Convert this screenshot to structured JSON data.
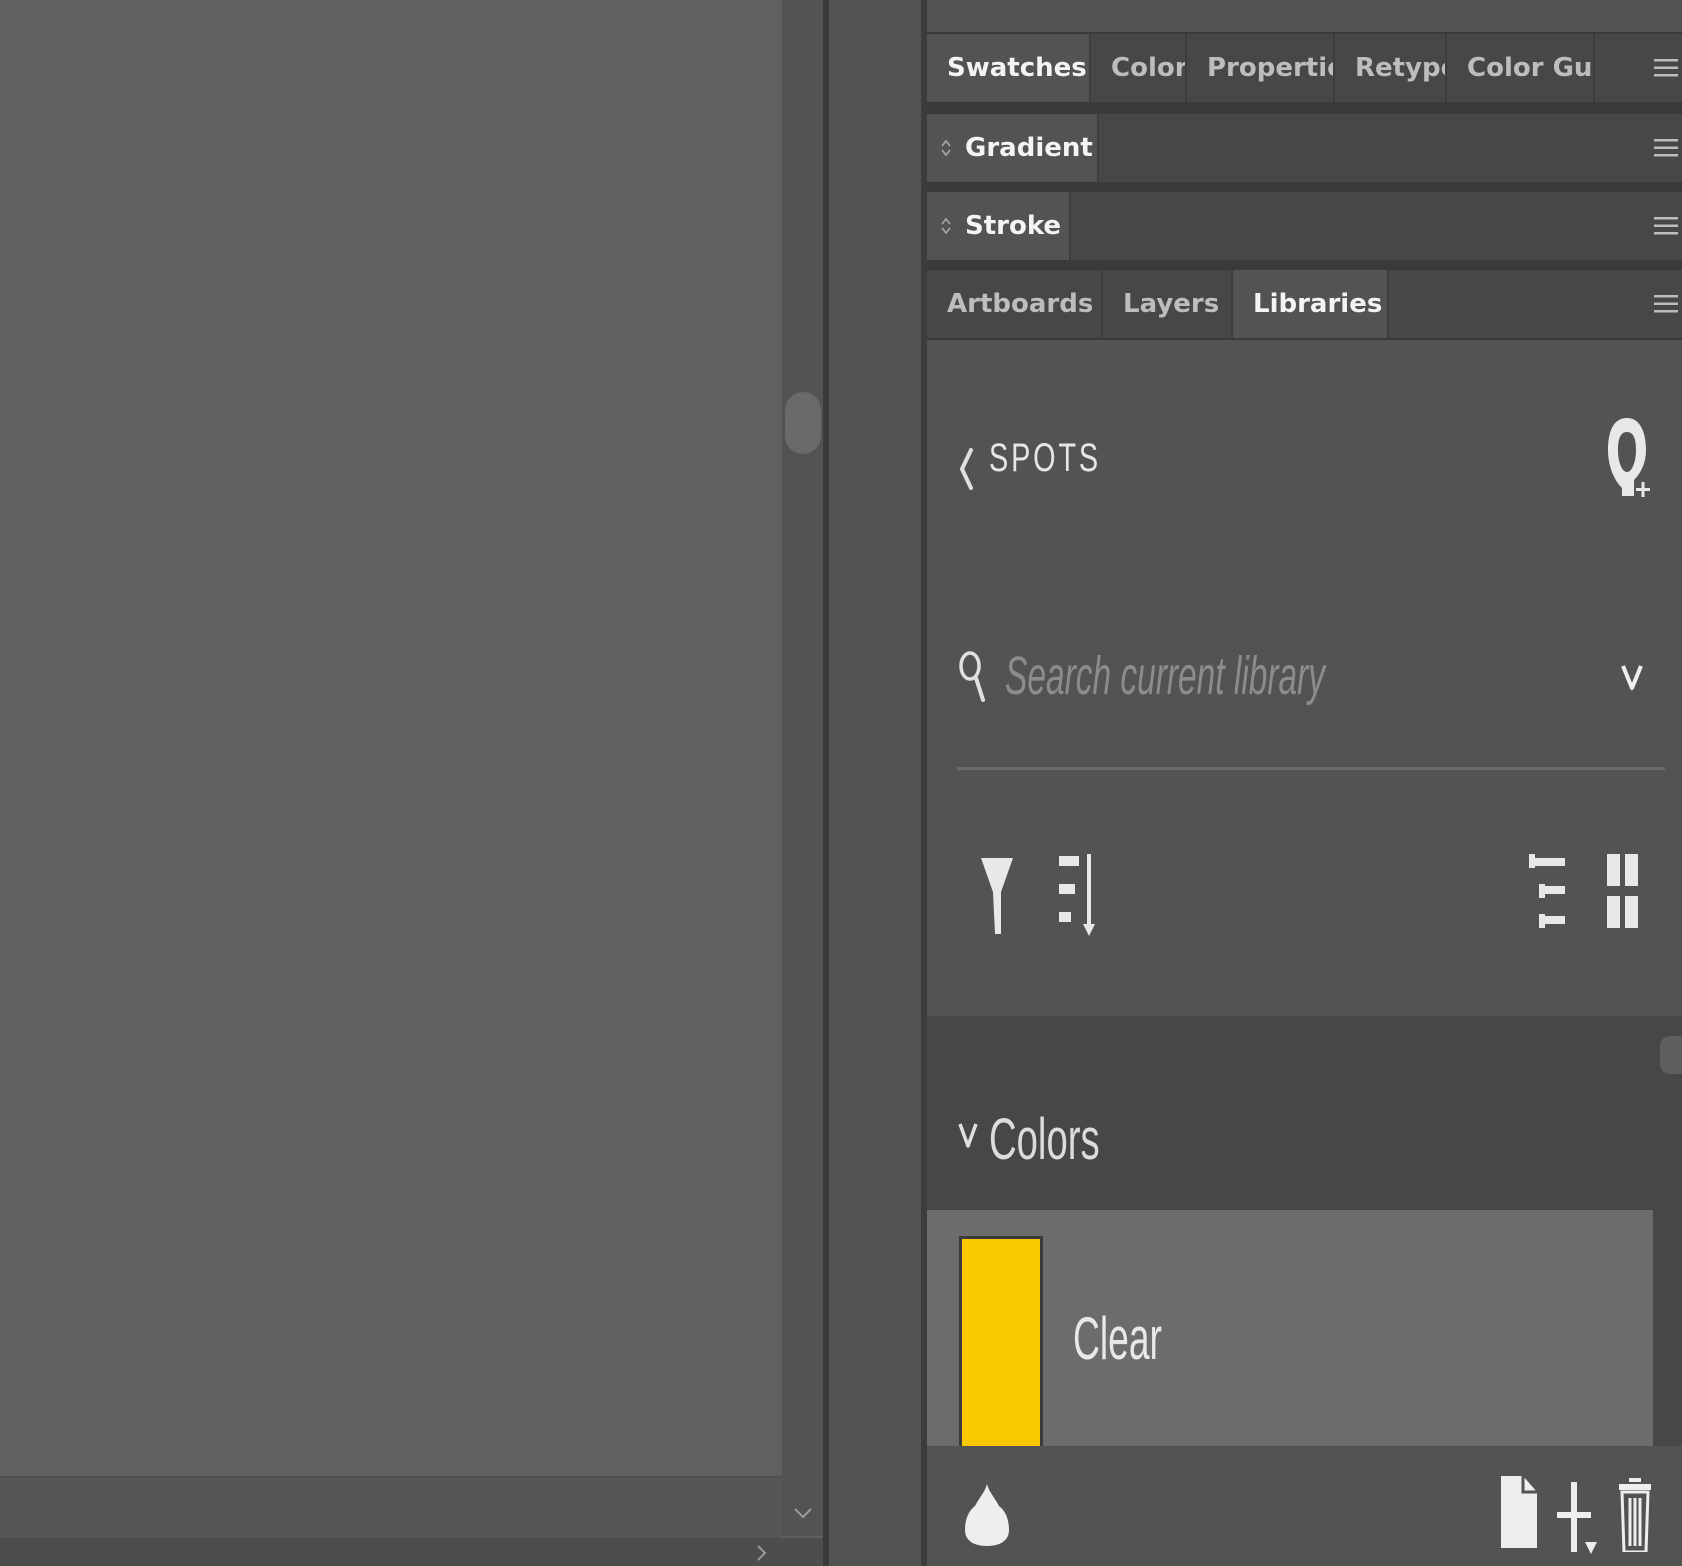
{
  "panel_groups": {
    "group1_tabs": [
      "Swatches",
      "Color",
      "Properties",
      "Retype",
      "Color Guide"
    ],
    "gradient_label": "Gradient",
    "stroke_label": "Stroke",
    "group4_tabs": [
      "Artboards",
      "Layers",
      "Libraries"
    ]
  },
  "libraries": {
    "library_name": "SPOTS",
    "search_placeholder": "Search current library",
    "section_title": "Colors",
    "items": [
      {
        "name": "Clear",
        "color": "#f8c900"
      }
    ]
  },
  "icons": {
    "panel_menu": "hamburger-menu-icon",
    "back": "chevron-left-icon",
    "invite": "add-user-icon",
    "search": "search-icon",
    "dropdown": "chevron-down-icon",
    "filter": "filter-icon",
    "sort": "sort-icon",
    "list_view": "list-view-icon",
    "grid_view": "grid-view-icon",
    "drop": "color-drop-icon",
    "new_item": "new-document-icon",
    "add": "plus-icon",
    "delete": "trash-icon"
  },
  "colors": {
    "panel_bg": "#535353",
    "panel_dark": "#474747",
    "accent_swatch": "#f8c900"
  }
}
